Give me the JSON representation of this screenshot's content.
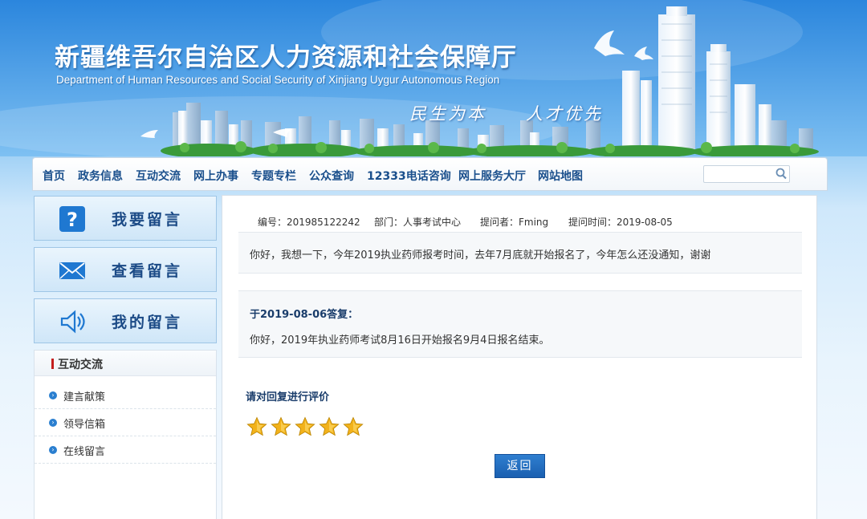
{
  "header": {
    "title": "新疆维吾尔自治区人力资源和社会保障厅",
    "subtitle": "Department of Human Resources and Social Security of Xinjiang Uygur Autonomous Region",
    "slogan_left": "民生为本",
    "slogan_right": "人才优先"
  },
  "nav": {
    "items": [
      "首页",
      "政务信息",
      "互动交流",
      "网上办事",
      "专题专栏",
      "公众查询",
      "12333电话咨询",
      "网上服务大厅",
      "网站地图"
    ],
    "search_placeholder": ""
  },
  "sidebar": {
    "buttons": [
      {
        "label": "我要留言",
        "icon": "question-icon"
      },
      {
        "label": "查看留言",
        "icon": "envelope-icon"
      },
      {
        "label": "我的留言",
        "icon": "speaker-icon"
      }
    ],
    "panel_title": "互动交流",
    "links": [
      "建言献策",
      "领导信箱",
      "在线留言"
    ]
  },
  "message": {
    "id_label": "编号：201985122242",
    "dept_label": "部门：人事考试中心",
    "asker_label": "提问者：Fming",
    "time_label": "提问时间：2019-08-05",
    "question": "你好，我想一下，今年2019执业药师报考时间，去年7月底就开始报名了，今年怎么还没通知，谢谢",
    "reply_heading": "于2019-08-06答复：",
    "reply": "你好，2019年执业药师考试8月16日开始报名9月4日报名结束。",
    "rating_title": "请对回复进行评价",
    "rating": 5,
    "rating_max": 5,
    "back_label": "返回"
  },
  "colors": {
    "nav_text": "#1a4f8c",
    "accent_blue": "#1a5fb0",
    "star": "#f2b21b"
  }
}
